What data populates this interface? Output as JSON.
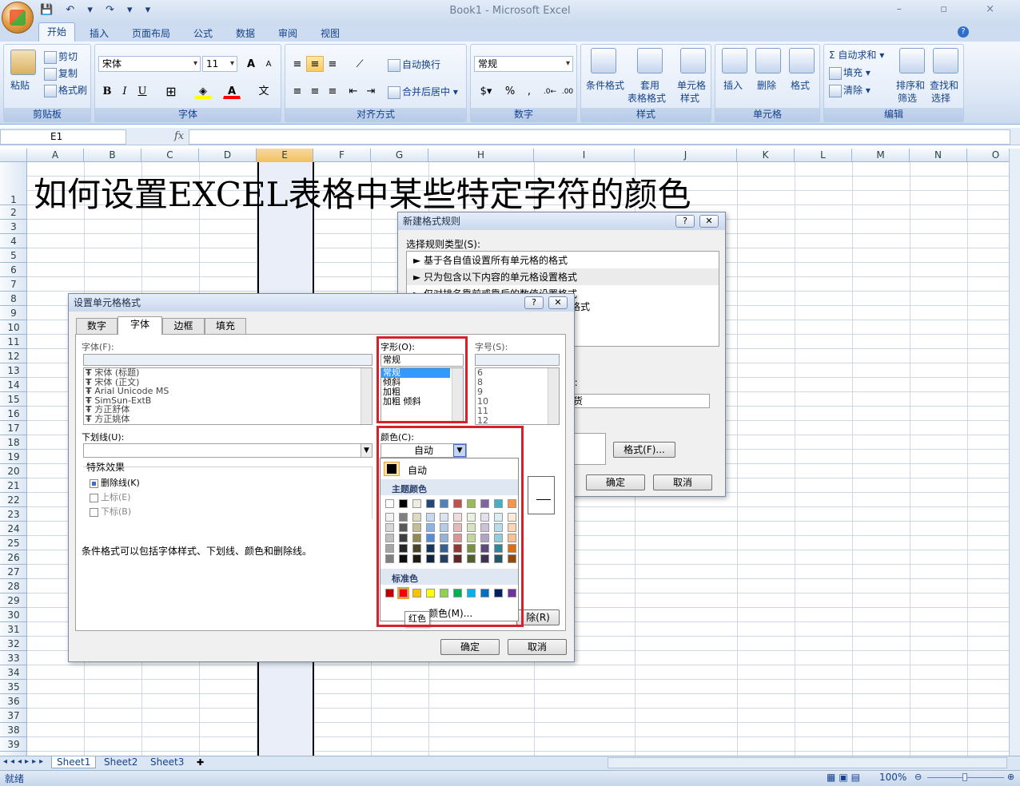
{
  "window": {
    "title": "Book1 - Microsoft Excel",
    "controls": "– ▫ ×"
  },
  "qat": "💾 ↶ ▾ ↷ ▾ ▾",
  "ribbon_tabs": [
    "开始",
    "插入",
    "页面布局",
    "公式",
    "数据",
    "审阅",
    "视图"
  ],
  "ribbon": {
    "clipboard": {
      "paste": "粘贴",
      "cut": "剪切",
      "copy": "复制",
      "format_painter": "格式刷",
      "label": "剪贴板"
    },
    "font": {
      "name": "宋体",
      "size": "11",
      "grow": "A",
      "shrink": "A",
      "bold": "B",
      "italic": "I",
      "underline": "U",
      "label": "字体"
    },
    "align": {
      "wrap": "自动换行",
      "merge": "合并后居中",
      "label": "对齐方式"
    },
    "number": {
      "format": "常规",
      "percent": "%",
      "comma": ",",
      "label": "数字"
    },
    "styles": {
      "cond": "条件格式",
      "table": "套用",
      "table2": "表格格式",
      "cell": "单元格",
      "cell2": "样式",
      "label": "样式"
    },
    "cells": {
      "insert": "插入",
      "delete": "删除",
      "format": "格式",
      "label": "单元格"
    },
    "edit": {
      "autosum": "自动求和",
      "fill": "填充",
      "clear": "清除",
      "sort": "排序和",
      "sort2": "筛选",
      "find": "查找和",
      "find2": "选择",
      "label": "编辑"
    }
  },
  "formula_bar": {
    "name_box": "E1",
    "fx": "fx"
  },
  "columns": [
    "A",
    "B",
    "C",
    "D",
    "E",
    "F",
    "G",
    "H",
    "I",
    "J",
    "K",
    "L",
    "M",
    "N",
    "O"
  ],
  "rows": [
    "1",
    "2",
    "3",
    "4",
    "5",
    "6",
    "7",
    "8",
    "9",
    "10",
    "11",
    "12",
    "13",
    "14",
    "15",
    "16",
    "17",
    "18",
    "19",
    "20",
    "21",
    "22",
    "23",
    "24",
    "25",
    "26",
    "27",
    "28",
    "29",
    "30",
    "31",
    "32",
    "33",
    "34",
    "35",
    "36",
    "37",
    "38",
    "39"
  ],
  "cell_a1": "如何设置EXCEL表格中某些特定字符的颜色",
  "new_rule_dialog": {
    "title": "新建格式规则",
    "select_type": "选择规则类型(S):",
    "rules": [
      "► 基于各自值设置所有单元格的格式",
      "► 只为包含以下内容的单元格设置格式",
      "► 仅对排名靠前或靠后的数值设置格式"
    ],
    "partial_rule": "格式",
    "partial_label": "):",
    "input_value": "货",
    "format_btn": "格式(F)...",
    "ok": "确定",
    "cancel": "取消"
  },
  "format_cells_dialog": {
    "title": "设置单元格格式",
    "tabs": [
      "数字",
      "字体",
      "边框",
      "填充"
    ],
    "font_label": "字体(F):",
    "fonts": [
      "宋体 (标题)",
      "宋体 (正文)",
      "Arial Unicode MS",
      "SimSun-ExtB",
      "方正舒体",
      "方正姚体"
    ],
    "style_label": "字形(O):",
    "style_value": "常规",
    "styles": [
      "常规",
      "倾斜",
      "加粗",
      "加粗 倾斜"
    ],
    "size_label": "字号(S):",
    "sizes": [
      "6",
      "8",
      "9",
      "10",
      "11",
      "12"
    ],
    "underline_label": "下划线(U):",
    "color_label": "颜色(C):",
    "color_value": "自动",
    "effects_label": "特殊效果",
    "strike": "删除线(K)",
    "superscript": "上标(E)",
    "subscript": "下标(B)",
    "note": "条件格式可以包括字体样式、下划线、颜色和删除线。",
    "clear_btn": "除(R)",
    "ok": "确定",
    "cancel": "取消"
  },
  "color_picker": {
    "auto": "自动",
    "theme_label": "主题颜色",
    "standard_label": "标准色",
    "more": "颜色(M)...",
    "tooltip": "红色",
    "theme_top": [
      "#ffffff",
      "#000000",
      "#eeece1",
      "#1f497d",
      "#4f81bd",
      "#c0504d",
      "#9bbb59",
      "#8064a2",
      "#4bacc6",
      "#f79646"
    ],
    "theme_cols": [
      [
        "#f2f2f2",
        "#d8d8d8",
        "#bfbfbf",
        "#a5a5a5",
        "#7f7f7f"
      ],
      [
        "#7f7f7f",
        "#595959",
        "#3f3f3f",
        "#262626",
        "#0c0c0c"
      ],
      [
        "#ddd9c3",
        "#c4bd97",
        "#938953",
        "#494429",
        "#1d1b10"
      ],
      [
        "#c6d9f0",
        "#8db3e2",
        "#548dd4",
        "#17365d",
        "#0f243e"
      ],
      [
        "#dbe5f1",
        "#b8cce4",
        "#95b3d7",
        "#366092",
        "#244061"
      ],
      [
        "#f2dcdb",
        "#e5b9b7",
        "#d99694",
        "#953734",
        "#632423"
      ],
      [
        "#ebf1dd",
        "#d7e3bc",
        "#c3d69b",
        "#76923c",
        "#4f6128"
      ],
      [
        "#e5e0ec",
        "#ccc1d9",
        "#b2a2c7",
        "#5f497a",
        "#3f3151"
      ],
      [
        "#dbeef3",
        "#b7dde8",
        "#92cddc",
        "#31859b",
        "#205867"
      ],
      [
        "#fdeada",
        "#fbd5b5",
        "#fac08f",
        "#e36c09",
        "#974806"
      ]
    ],
    "standard": [
      "#c00000",
      "#ff0000",
      "#ffc000",
      "#ffff00",
      "#92d050",
      "#00b050",
      "#00b0f0",
      "#0070c0",
      "#002060",
      "#7030a0"
    ]
  },
  "sheet_tabs": [
    "Sheet1",
    "Sheet2",
    "Sheet3"
  ],
  "status": {
    "ready": "就绪",
    "zoom": "100%"
  }
}
